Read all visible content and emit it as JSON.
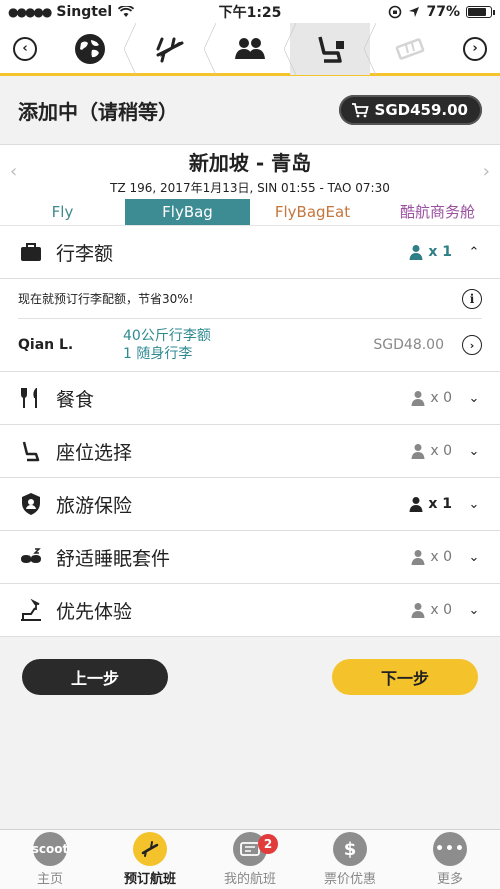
{
  "status_bar": {
    "carrier": "Singtel",
    "time": "下午1:25",
    "battery": "77%",
    "battery_level": 0.77
  },
  "step_nav": {
    "steps": [
      "globe",
      "flight",
      "passengers",
      "seat-addons",
      "ticket"
    ],
    "active_index": 3
  },
  "header": {
    "title": "添加中（请稍等）",
    "total_price": "SGD459.00"
  },
  "route": {
    "cities": "新加坡 - 青岛",
    "detail": "TZ 196, 2017年1月13日, SIN 01:55 - TAO 07:30"
  },
  "tabs": [
    {
      "label": "Fly"
    },
    {
      "label": "FlyBag"
    },
    {
      "label": "FlyBagEat"
    },
    {
      "label": "酷航商务舱"
    }
  ],
  "baggage": {
    "label": "行李额",
    "count": "x 1",
    "promo": "现在就预订行李配额，节省30%!",
    "passenger": "Qian L.",
    "item1": "40公斤行李额",
    "item2": "1 随身行李",
    "price": "SGD48.00"
  },
  "rows": [
    {
      "label": "餐食",
      "count": "x 0"
    },
    {
      "label": "座位选择",
      "count": "x 0"
    },
    {
      "label": "旅游保险",
      "count": "x 1"
    },
    {
      "label": "舒适睡眠套件",
      "count": "x 0"
    },
    {
      "label": "优先体验",
      "count": "x 0"
    }
  ],
  "buttons": {
    "prev": "上一步",
    "next": "下一步"
  },
  "tabbar": {
    "home": "主页",
    "home_icon_text": "scoot",
    "book": "预订航班",
    "my_flights": "我的航班",
    "my_flights_badge": "2",
    "deals": "票价优惠",
    "more": "更多"
  },
  "colors": {
    "accent_yellow": "#f4c32c",
    "teal": "#3d8b93",
    "dark": "#2a2a2a"
  }
}
